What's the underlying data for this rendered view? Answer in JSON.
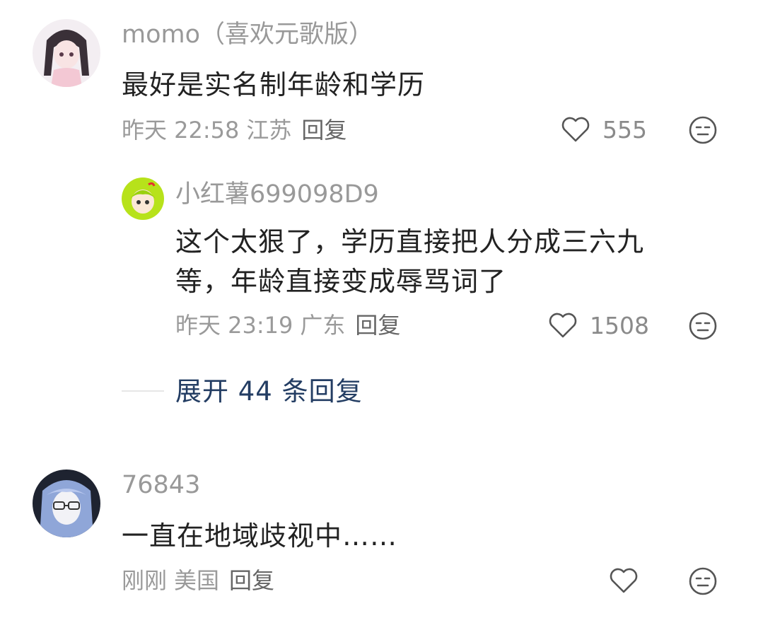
{
  "comments": [
    {
      "username": "momo（喜欢元歌版）",
      "content": "最好是实名制年龄和学历",
      "time": "昨天 22:58",
      "location": "江苏",
      "reply_label": "回复",
      "likes": "555",
      "avatar_icon": "anime-girl-avatar",
      "reply": {
        "username": "小红薯699098D9",
        "content": "这个太狠了，学历直接把人分成三六九等，年龄直接变成辱骂词了",
        "time": "昨天 23:19",
        "location": "广东",
        "reply_label": "回复",
        "likes": "1508",
        "avatar_icon": "green-cartoon-avatar"
      },
      "expand_label": "展开 44 条回复"
    },
    {
      "username": "76843",
      "content": "一直在地域歧视中……",
      "time": "刚刚",
      "location": "美国",
      "reply_label": "回复",
      "likes": "",
      "avatar_icon": "blue-hair-glasses-avatar"
    }
  ],
  "icons": {
    "like": "heart-outline-icon",
    "dislike": "meh-face-icon"
  },
  "colors": {
    "text": "#222222",
    "meta": "#9a9a9a",
    "username": "#999999",
    "expand": "#233d63",
    "icon": "#555555"
  }
}
